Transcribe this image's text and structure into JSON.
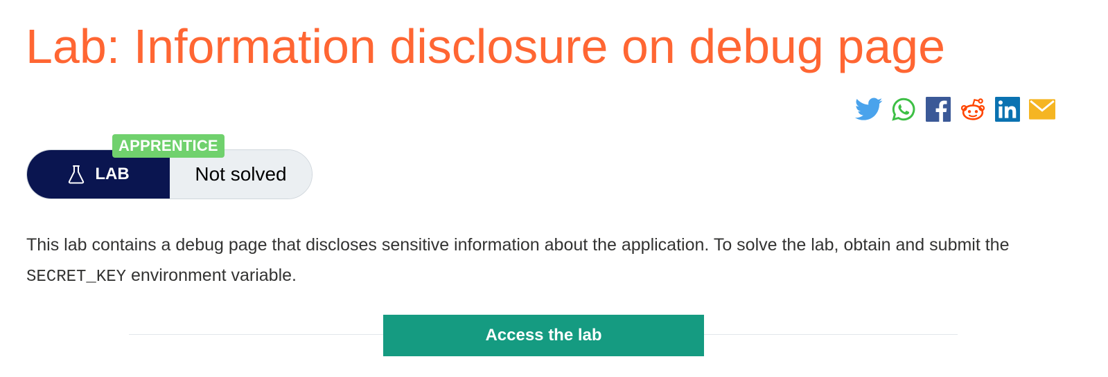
{
  "lab": {
    "title": "Lab: Information disclosure on debug page",
    "level": "APPRENTICE",
    "type_label": "LAB",
    "status": "Not solved",
    "description": {
      "before": "This lab contains a debug page that discloses sensitive information about the application. To solve the lab, obtain and submit the ",
      "code": "SECRET_KEY",
      "after": " environment variable."
    },
    "access_button": "Access the lab"
  },
  "share": {
    "icons": [
      "twitter-icon",
      "whatsapp-icon",
      "facebook-icon",
      "reddit-icon",
      "linkedin-icon",
      "email-icon"
    ]
  },
  "colors": {
    "title": "#ff6633",
    "level_badge": "#70d16d",
    "lab_type_bg": "#0a1550",
    "status_bg": "#ebeff2",
    "access_button": "#159b81",
    "twitter": "#4aa3ec",
    "whatsapp": "#3dbf45",
    "facebook": "#3b5997",
    "reddit": "#ff4500",
    "linkedin": "#0a72b1",
    "email": "#f5b522"
  }
}
